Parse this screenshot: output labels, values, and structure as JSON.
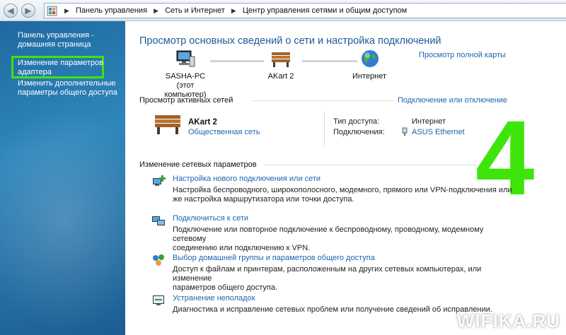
{
  "breadcrumb": [
    "Панель управления",
    "Сеть и Интернет",
    "Центр управления сетями и общим доступом"
  ],
  "sidebar": {
    "items": [
      {
        "label_1": "Панель управления -",
        "label_2": "домашняя страница"
      },
      {
        "label_1": "Изменение параметров",
        "label_2": "адаптера"
      },
      {
        "label_1": "Изменить дополнительные",
        "label_2": "параметры общего доступа"
      }
    ]
  },
  "main": {
    "title": "Просмотр основных сведений о сети и настройка подключений",
    "full_map_link": "Просмотр полной карты",
    "map": {
      "computer_name": "SASHA-PC",
      "computer_sub": "(этот компьютер)",
      "network_name": "AKart  2",
      "internet": "Интернет"
    },
    "active_networks_header": "Просмотр активных сетей",
    "connect_disconnect_link": "Подключение или отключение",
    "network": {
      "name": "AKart  2",
      "type": "Общественная сеть",
      "access_type_label": "Тип доступа:",
      "access_type_value": "Интернет",
      "connections_label": "Подключения:",
      "connections_value": "ASUS Ethernet"
    },
    "change_settings_header": "Изменение сетевых параметров",
    "tasks": [
      {
        "link": "Настройка нового подключения или сети",
        "desc_1": "Настройка беспроводного, широкополосного, модемного, прямого или VPN-подключения или",
        "desc_2": "же настройка маршрутизатора или точки доступа."
      },
      {
        "link": "Подключиться к сети",
        "desc_1": "Подключение или повторное подключение к беспроводному, проводному, модемному сетевому",
        "desc_2": "соединению или подключению к VPN."
      },
      {
        "link": "Выбор домашней группы и параметров общего доступа",
        "desc_1": "Доступ к файлам и принтерам, расположенным на других сетевых компьютерах, или изменение",
        "desc_2": "параметров общего доступа."
      },
      {
        "link": "Устранение неполадок",
        "desc_1": "Диагностика и исправление сетевых проблем или получение сведений об исправлении.",
        "desc_2": ""
      }
    ]
  },
  "annotation": "4",
  "watermark": "WIFIKA.RU"
}
